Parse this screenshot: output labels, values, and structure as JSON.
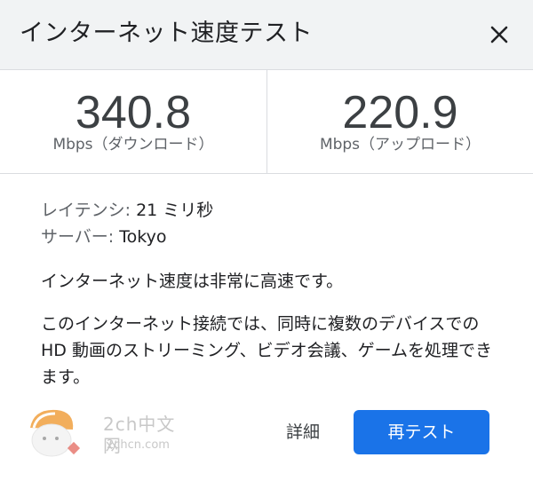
{
  "header": {
    "title": "インターネット速度テスト"
  },
  "results": {
    "download": {
      "value": "340.8",
      "unit": "Mbps（ダウンロード）"
    },
    "upload": {
      "value": "220.9",
      "unit": "Mbps（アップロード）"
    }
  },
  "details": {
    "latency_label": "レイテンシ:",
    "latency_value": " 21 ミリ秒",
    "server_label": "サーバー:",
    "server_value": " Tokyo"
  },
  "summary": "インターネット速度は非常に高速です。",
  "description": "このインターネット接続では、同時に複数のデバイスでの HD 動画のストリーミング、ビデオ会議、ゲームを処理できます。",
  "actions": {
    "details_label": "詳細",
    "retest_label": "再テスト"
  },
  "watermark": {
    "line1": "2ch中文网",
    "line2": "2chcn.com"
  },
  "colors": {
    "accent": "#1a73e8",
    "header_bg": "#f1f3f4",
    "divider": "#dadce0"
  },
  "icons": {
    "close": "close-icon"
  }
}
